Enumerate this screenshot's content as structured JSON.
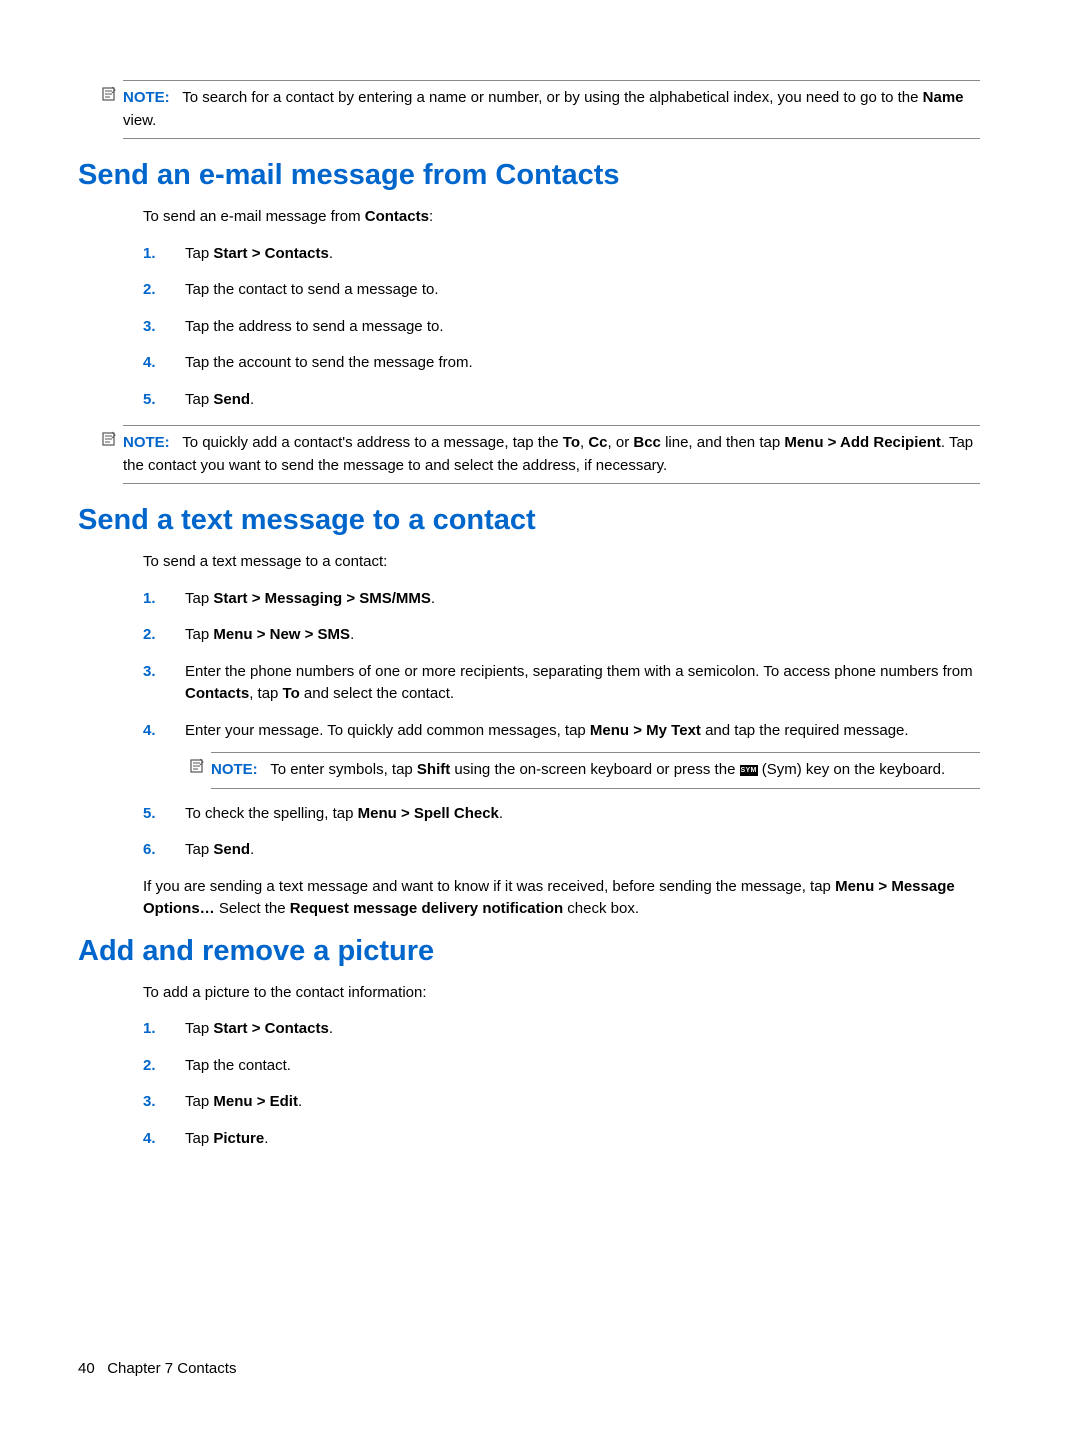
{
  "note1": {
    "label": "NOTE:",
    "text_before": "To search for a contact by entering a name or number, or by using the alphabetical index, you need to go to the ",
    "bold1": "Name",
    "text_after": " view."
  },
  "section1": {
    "heading": "Send an e-mail message from Contacts",
    "intro_before": "To send an e-mail message from ",
    "intro_bold": "Contacts",
    "intro_after": ":",
    "steps": {
      "s1": {
        "num": "1.",
        "t1": "Tap ",
        "b1": "Start > Contacts",
        "t2": "."
      },
      "s2": {
        "num": "2.",
        "t1": "Tap the contact to send a message to."
      },
      "s3": {
        "num": "3.",
        "t1": "Tap the address to send a message to."
      },
      "s4": {
        "num": "4.",
        "t1": "Tap the account to send the message from."
      },
      "s5": {
        "num": "5.",
        "t1": "Tap ",
        "b1": "Send",
        "t2": "."
      }
    }
  },
  "note2": {
    "label": "NOTE:",
    "t1": "To quickly add a contact's address to a message, tap the ",
    "b1": "To",
    "t2": ", ",
    "b2": "Cc",
    "t3": ", or ",
    "b3": "Bcc",
    "t4": " line, and then tap ",
    "b4": "Menu > Add Recipient",
    "t5": ". Tap the contact you want to send the message to and select the address, if necessary."
  },
  "section2": {
    "heading": "Send a text message to a contact",
    "intro": "To send a text message to a contact:",
    "steps": {
      "s1": {
        "num": "1.",
        "t1": "Tap ",
        "b1": "Start > Messaging > SMS/MMS",
        "t2": "."
      },
      "s2": {
        "num": "2.",
        "t1": "Tap ",
        "b1": "Menu > New > SMS",
        "t2": "."
      },
      "s3": {
        "num": "3.",
        "t1": "Enter the phone numbers of one or more recipients, separating them with a semicolon. To access phone numbers from ",
        "b1": "Contacts",
        "t2": ", tap ",
        "b2": "To",
        "t3": " and select the contact."
      },
      "s4": {
        "num": "4.",
        "t1": "Enter your message. To quickly add common messages, tap ",
        "b1": "Menu > My Text",
        "t2": " and tap the required message."
      },
      "note": {
        "label": "NOTE:",
        "t1": "To enter symbols, tap ",
        "b1": "Shift",
        "t2": " using the on-screen keyboard or press the ",
        "sym": "SYM",
        "t3": " (Sym) key on the keyboard."
      },
      "s5": {
        "num": "5.",
        "t1": "To check the spelling, tap ",
        "b1": "Menu > Spell Check",
        "t2": "."
      },
      "s6": {
        "num": "6.",
        "t1": "Tap ",
        "b1": "Send",
        "t2": "."
      }
    },
    "para": {
      "t1": "If you are sending a text message and want to know if it was received, before sending the message, tap ",
      "b1": "Menu > Message Options…",
      "t2": " Select the ",
      "b2": "Request message delivery notification",
      "t3": " check box."
    }
  },
  "section3": {
    "heading": "Add and remove a picture",
    "intro": "To add a picture to the contact information:",
    "steps": {
      "s1": {
        "num": "1.",
        "t1": "Tap ",
        "b1": "Start > Contacts",
        "t2": "."
      },
      "s2": {
        "num": "2.",
        "t1": "Tap the contact."
      },
      "s3": {
        "num": "3.",
        "t1": "Tap ",
        "b1": "Menu > Edit",
        "t2": "."
      },
      "s4": {
        "num": "4.",
        "t1": "Tap ",
        "b1": "Picture",
        "t2": "."
      }
    }
  },
  "footer": {
    "page": "40",
    "chapter": "Chapter 7   Contacts"
  }
}
